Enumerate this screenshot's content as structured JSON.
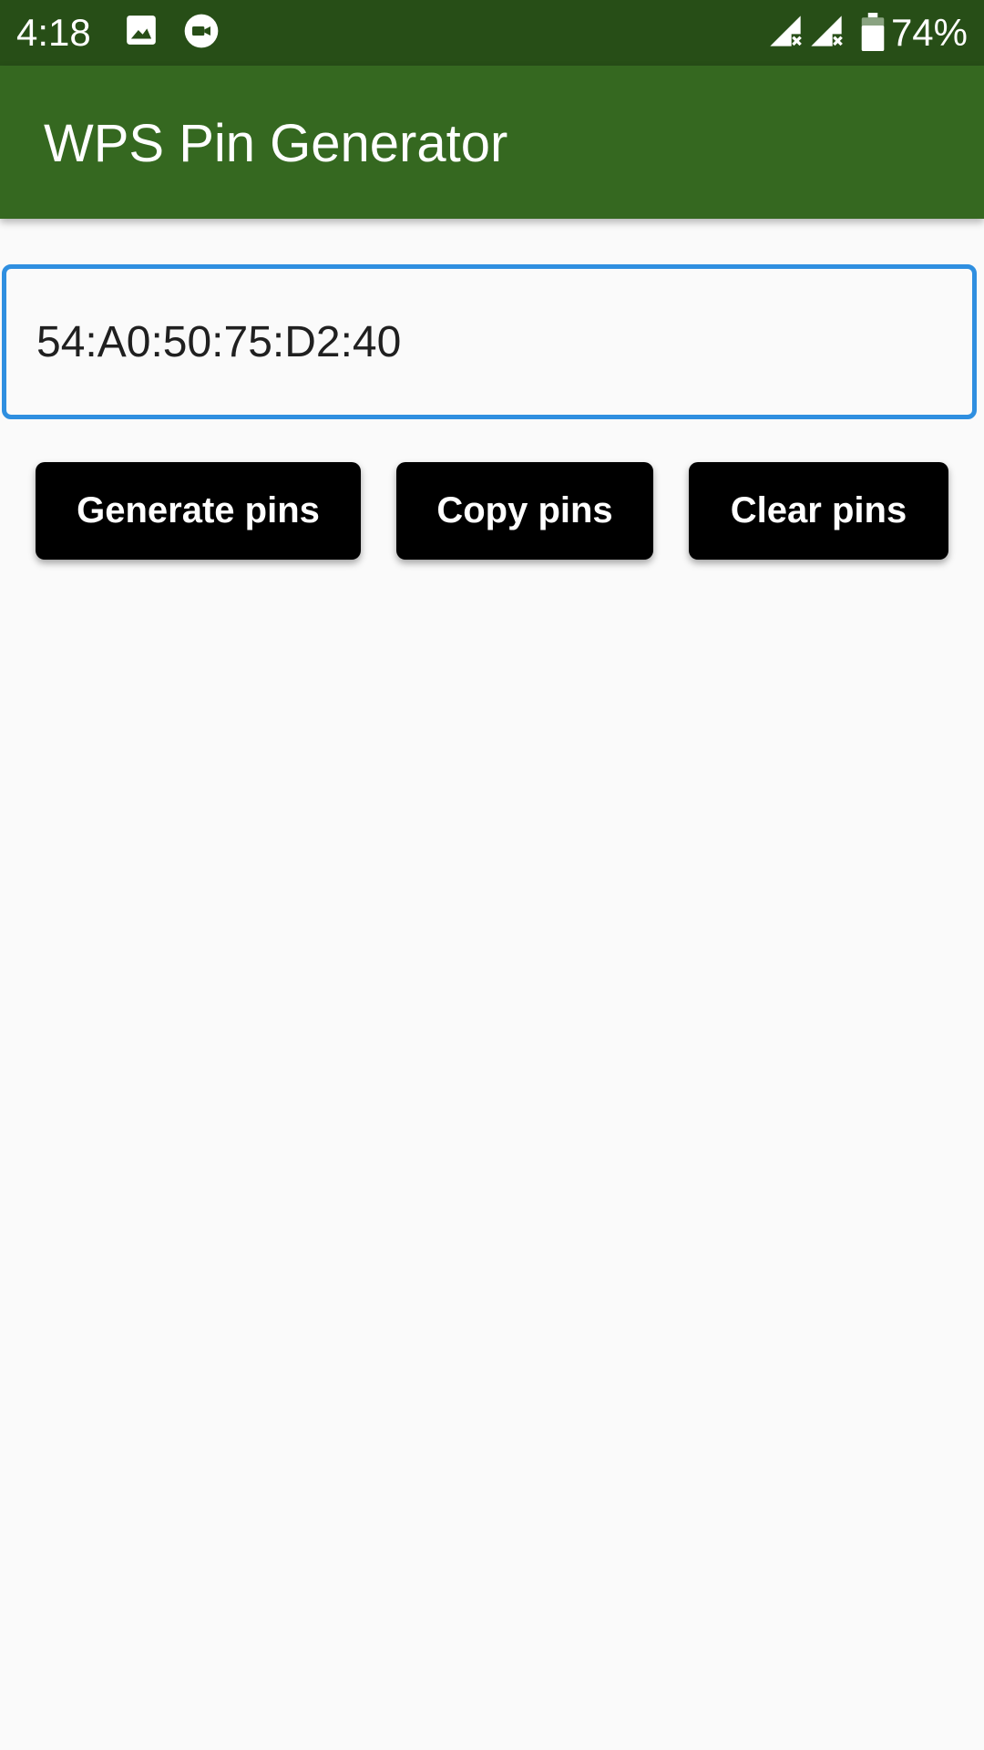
{
  "status_bar": {
    "time": "4:18",
    "battery_percent": "74%",
    "icons": [
      "image-icon",
      "video-call-icon",
      "signal-no-service-icon",
      "signal-no-service-icon",
      "battery-icon"
    ]
  },
  "app_bar": {
    "title": "WPS Pin Generator"
  },
  "mac_input": {
    "value": "54:A0:50:75:D2:40"
  },
  "buttons": {
    "generate_label": "Generate pins",
    "copy_label": "Copy pins",
    "clear_label": "Clear pins"
  },
  "colors": {
    "status_bar": "#274e17",
    "app_bar": "#356820",
    "input_border": "#2f8fe0",
    "button_bg": "#000000",
    "background": "#fafafa"
  }
}
